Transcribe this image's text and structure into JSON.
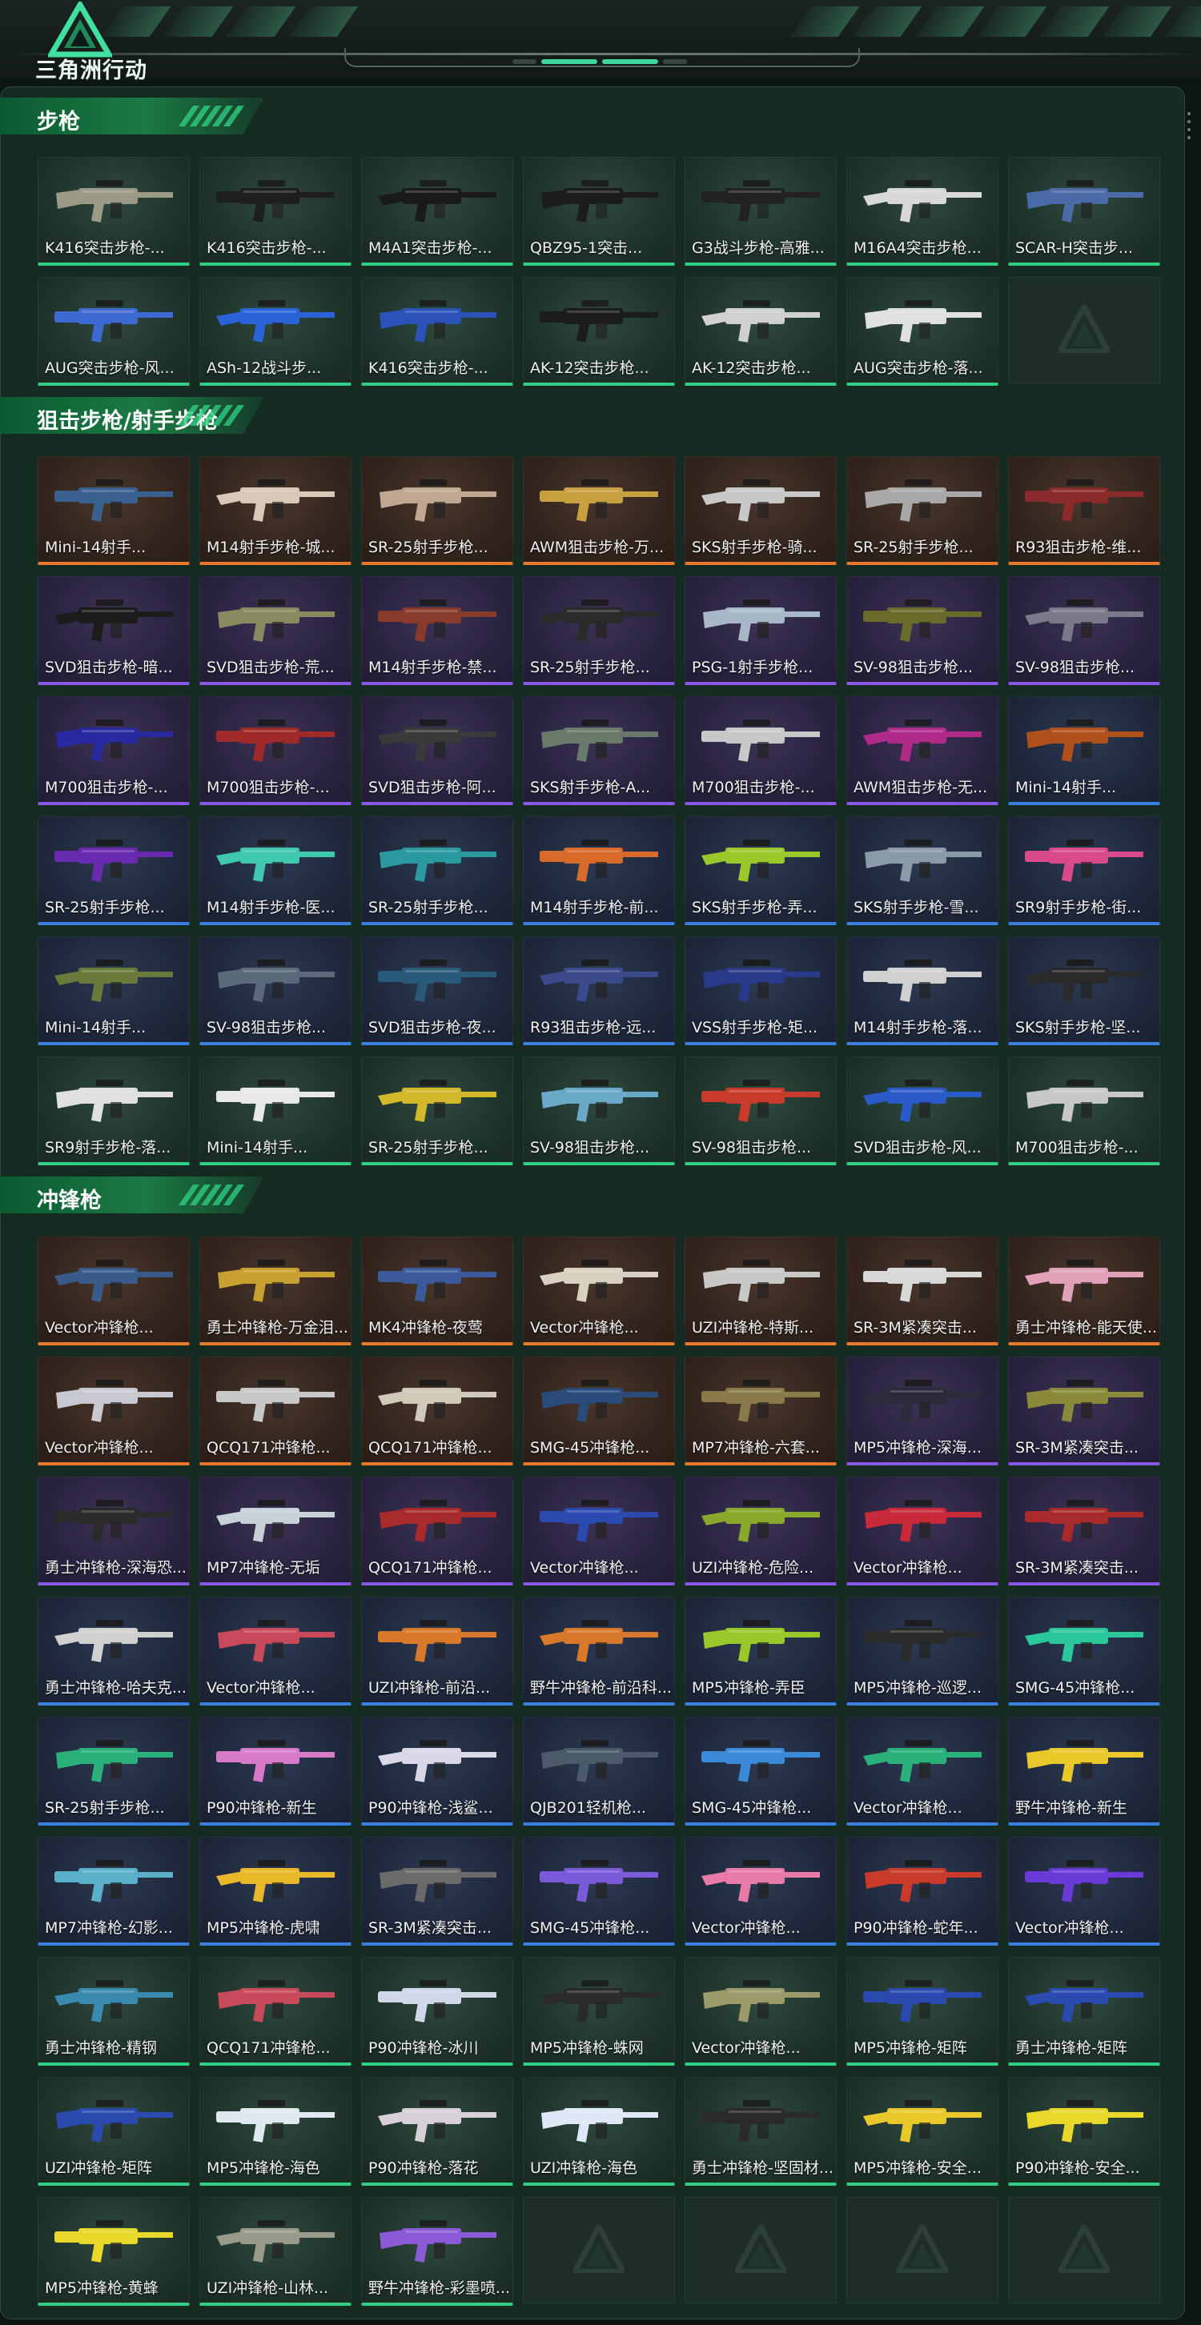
{
  "header": {
    "app_title": "三角洲行动",
    "logo_icon": "delta-logo-icon"
  },
  "rarity_colors": {
    "green": "#2fcf86",
    "orange": "#e8782a",
    "purple": "#8a58e6",
    "blue": "#3b7fe0"
  },
  "sections": [
    {
      "title": "步枪",
      "items": [
        {
          "name": "K416突击步枪-...",
          "rarity": "green",
          "gun_color": "#9a9a86"
        },
        {
          "name": "K416突击步枪-...",
          "rarity": "green",
          "gun_color": "#1e1e1e"
        },
        {
          "name": "M4A1突击步枪-...",
          "rarity": "green",
          "gun_color": "#1a1a1a"
        },
        {
          "name": "QBZ95-1突击...",
          "rarity": "green",
          "gun_color": "#1c1c1c"
        },
        {
          "name": "G3战斗步枪-高雅...",
          "rarity": "green",
          "gun_color": "#222222"
        },
        {
          "name": "M16A4突击步枪...",
          "rarity": "green",
          "gun_color": "#d8d8d8"
        },
        {
          "name": "SCAR-H突击步...",
          "rarity": "green",
          "gun_color": "#4a6aa8"
        },
        {
          "name": "AUG突击步枪-风...",
          "rarity": "green",
          "gun_color": "#3c6ad0"
        },
        {
          "name": "ASh-12战斗步...",
          "rarity": "green",
          "gun_color": "#2a62d8"
        },
        {
          "name": "K416突击步枪-...",
          "rarity": "green",
          "gun_color": "#2a52b8"
        },
        {
          "name": "AK-12突击步枪...",
          "rarity": "green",
          "gun_color": "#1c1c1c"
        },
        {
          "name": "AK-12突击步枪...",
          "rarity": "green",
          "gun_color": "#d0d0d0"
        },
        {
          "name": "AUG突击步枪-落...",
          "rarity": "green",
          "gun_color": "#e0e0e0"
        },
        {
          "name": "",
          "rarity": "empty"
        }
      ]
    },
    {
      "title": "狙击步枪/射手步枪",
      "items": [
        {
          "name": "Mini-14射手...",
          "rarity": "orange",
          "gun_color": "#3a6090"
        },
        {
          "name": "M14射手步枪-城...",
          "rarity": "orange",
          "gun_color": "#d8c8b8"
        },
        {
          "name": "SR-25射手步枪...",
          "rarity": "orange",
          "gun_color": "#c0a890"
        },
        {
          "name": "AWM狙击步枪-万...",
          "rarity": "orange",
          "gun_color": "#c8a040"
        },
        {
          "name": "SKS射手步枪-骑...",
          "rarity": "orange",
          "gun_color": "#c8c8c8"
        },
        {
          "name": "SR-25射手步枪...",
          "rarity": "orange",
          "gun_color": "#a8a8a8"
        },
        {
          "name": "R93狙击步枪-维...",
          "rarity": "orange",
          "gun_color": "#8a2a2a"
        },
        {
          "name": "SVD狙击步枪-暗...",
          "rarity": "purple",
          "gun_color": "#1c1c1c"
        },
        {
          "name": "SVD狙击步枪-荒...",
          "rarity": "purple",
          "gun_color": "#8a8a60"
        },
        {
          "name": "M14射手步枪-禁...",
          "rarity": "purple",
          "gun_color": "#8a3a2a"
        },
        {
          "name": "SR-25射手步枪...",
          "rarity": "purple",
          "gun_color": "#2a2a2a"
        },
        {
          "name": "PSG-1射手步枪...",
          "rarity": "purple",
          "gun_color": "#a8b8c8"
        },
        {
          "name": "SV-98狙击步枪...",
          "rarity": "purple",
          "gun_color": "#6a6a2a"
        },
        {
          "name": "SV-98狙击步枪...",
          "rarity": "purple",
          "gun_color": "#7a7a8a"
        },
        {
          "name": "M700狙击步枪-...",
          "rarity": "purple",
          "gun_color": "#2a2aa0"
        },
        {
          "name": "M700狙击步枪-...",
          "rarity": "purple",
          "gun_color": "#a02a2a"
        },
        {
          "name": "SVD狙击步枪-阿...",
          "rarity": "purple",
          "gun_color": "#3a3a3a"
        },
        {
          "name": "SKS射手步枪-A...",
          "rarity": "purple",
          "gun_color": "#6a7a6a"
        },
        {
          "name": "M700狙击步枪-...",
          "rarity": "purple",
          "gun_color": "#c8c8c8"
        },
        {
          "name": "AWM狙击步枪-无...",
          "rarity": "purple",
          "gun_color": "#b02a8a"
        },
        {
          "name": "Mini-14射手...",
          "rarity": "blue",
          "gun_color": "#b0501a"
        },
        {
          "name": "SR-25射手步枪...",
          "rarity": "blue",
          "gun_color": "#6a2ab0"
        },
        {
          "name": "M14射手步枪-医...",
          "rarity": "blue",
          "gun_color": "#40c8b0"
        },
        {
          "name": "SR-25射手步枪...",
          "rarity": "blue",
          "gun_color": "#2a9aa0"
        },
        {
          "name": "M14射手步枪-前...",
          "rarity": "blue",
          "gun_color": "#d86a2a"
        },
        {
          "name": "SKS射手步枪-弄...",
          "rarity": "blue",
          "gun_color": "#9ac82a"
        },
        {
          "name": "SKS射手步枪-雪...",
          "rarity": "blue",
          "gun_color": "#8a9aa8"
        },
        {
          "name": "SR9射手步枪-街...",
          "rarity": "blue",
          "gun_color": "#d84a8a"
        },
        {
          "name": "Mini-14射手...",
          "rarity": "blue",
          "gun_color": "#6a7a3a"
        },
        {
          "name": "SV-98狙击步枪...",
          "rarity": "blue",
          "gun_color": "#5a6a7a"
        },
        {
          "name": "SVD狙击步枪-夜...",
          "rarity": "blue",
          "gun_color": "#2a5a7a"
        },
        {
          "name": "R93狙击步枪-远...",
          "rarity": "blue",
          "gun_color": "#3a4a8a"
        },
        {
          "name": "VSS射手步枪-矩...",
          "rarity": "blue",
          "gun_color": "#2a3a8a"
        },
        {
          "name": "M14射手步枪-落...",
          "rarity": "blue",
          "gun_color": "#d0d0d0"
        },
        {
          "name": "SKS射手步枪-坚...",
          "rarity": "blue",
          "gun_color": "#2a2a2a"
        },
        {
          "name": "SR9射手步枪-落...",
          "rarity": "green",
          "gun_color": "#e0e0e0"
        },
        {
          "name": "Mini-14射手...",
          "rarity": "green",
          "gun_color": "#e8e8e8"
        },
        {
          "name": "SR-25射手步枪...",
          "rarity": "green",
          "gun_color": "#d0b82a"
        },
        {
          "name": "SV-98狙击步枪...",
          "rarity": "green",
          "gun_color": "#6aa8c8"
        },
        {
          "name": "SV-98狙击步枪...",
          "rarity": "green",
          "gun_color": "#c83a2a"
        },
        {
          "name": "SVD狙击步枪-风...",
          "rarity": "green",
          "gun_color": "#2a5ac8"
        },
        {
          "name": "M700狙击步枪-...",
          "rarity": "green",
          "gun_color": "#c8c8c8"
        }
      ]
    },
    {
      "title": "冲锋枪",
      "items": [
        {
          "name": "Vector冲锋枪...",
          "rarity": "orange",
          "gun_color": "#3a5a8a"
        },
        {
          "name": "勇士冲锋枪-万金泪...",
          "rarity": "orange",
          "gun_color": "#c8a030"
        },
        {
          "name": "MK4冲锋枪-夜莺",
          "rarity": "orange",
          "gun_color": "#3a5a9a"
        },
        {
          "name": "Vector冲锋枪...",
          "rarity": "orange",
          "gun_color": "#d8d0c0"
        },
        {
          "name": "UZI冲锋枪-特斯...",
          "rarity": "orange",
          "gun_color": "#c8c8c8"
        },
        {
          "name": "SR-3M紧凑突击...",
          "rarity": "orange",
          "gun_color": "#d8d8d8"
        },
        {
          "name": "勇士冲锋枪-能天使...",
          "rarity": "orange",
          "gun_color": "#e0a0b8"
        },
        {
          "name": "Vector冲锋枪...",
          "rarity": "orange",
          "gun_color": "#c8c8d0"
        },
        {
          "name": "QCQ171冲锋枪...",
          "rarity": "orange",
          "gun_color": "#c8c8c8"
        },
        {
          "name": "QCQ171冲锋枪...",
          "rarity": "orange",
          "gun_color": "#d0c8b8"
        },
        {
          "name": "SMG-45冲锋枪...",
          "rarity": "orange",
          "gun_color": "#2a4a7a"
        },
        {
          "name": "MP7冲锋枪-六套...",
          "rarity": "orange",
          "gun_color": "#8a7a4a"
        },
        {
          "name": "MP5冲锋枪-深海...",
          "rarity": "purple",
          "gun_color": "#2a2a3a"
        },
        {
          "name": "SR-3M紧凑突击...",
          "rarity": "purple",
          "gun_color": "#8a8a3a"
        },
        {
          "name": "勇士冲锋枪-深海恐...",
          "rarity": "purple",
          "gun_color": "#2a2a2a"
        },
        {
          "name": "MP7冲锋枪-无垢",
          "rarity": "purple",
          "gun_color": "#c8d0d8"
        },
        {
          "name": "QCQ171冲锋枪...",
          "rarity": "purple",
          "gun_color": "#a82a2a"
        },
        {
          "name": "Vector冲锋枪...",
          "rarity": "purple",
          "gun_color": "#2a4ab0"
        },
        {
          "name": "UZI冲锋枪-危险...",
          "rarity": "purple",
          "gun_color": "#8aa82a"
        },
        {
          "name": "Vector冲锋枪...",
          "rarity": "purple",
          "gun_color": "#c82a3a"
        },
        {
          "name": "SR-3M紧凑突击...",
          "rarity": "purple",
          "gun_color": "#a82a2a"
        },
        {
          "name": "勇士冲锋枪-哈夫克...",
          "rarity": "blue",
          "gun_color": "#d0d0d0"
        },
        {
          "name": "Vector冲锋枪...",
          "rarity": "blue",
          "gun_color": "#c84a5a"
        },
        {
          "name": "UZI冲锋枪-前沿...",
          "rarity": "blue",
          "gun_color": "#d8782a"
        },
        {
          "name": "野牛冲锋枪-前沿科...",
          "rarity": "blue",
          "gun_color": "#d8782a"
        },
        {
          "name": "MP5冲锋枪-弄臣",
          "rarity": "blue",
          "gun_color": "#9ac82a"
        },
        {
          "name": "MP5冲锋枪-巡逻...",
          "rarity": "blue",
          "gun_color": "#2a2a2a"
        },
        {
          "name": "SMG-45冲锋枪...",
          "rarity": "blue",
          "gun_color": "#2ac89a"
        },
        {
          "name": "SR-25射手步枪...",
          "rarity": "blue",
          "gun_color": "#2ab07a"
        },
        {
          "name": "P90冲锋枪-新生",
          "rarity": "blue",
          "gun_color": "#d87ac8"
        },
        {
          "name": "P90冲锋枪-浅鲨...",
          "rarity": "blue",
          "gun_color": "#d8d8e8"
        },
        {
          "name": "QJB201轻机枪...",
          "rarity": "blue",
          "gun_color": "#4a5a6a"
        },
        {
          "name": "SMG-45冲锋枪...",
          "rarity": "blue",
          "gun_color": "#3a8ad8"
        },
        {
          "name": "Vector冲锋枪...",
          "rarity": "blue",
          "gun_color": "#2ab07a"
        },
        {
          "name": "野牛冲锋枪-新生",
          "rarity": "blue",
          "gun_color": "#e8c82a"
        },
        {
          "name": "MP7冲锋枪-幻影...",
          "rarity": "blue",
          "gun_color": "#5ab0c8"
        },
        {
          "name": "MP5冲锋枪-虎啸",
          "rarity": "blue",
          "gun_color": "#e8b82a"
        },
        {
          "name": "SR-3M紧凑突击...",
          "rarity": "blue",
          "gun_color": "#6a6a6a"
        },
        {
          "name": "SMG-45冲锋枪...",
          "rarity": "blue",
          "gun_color": "#7a5ad8"
        },
        {
          "name": "Vector冲锋枪...",
          "rarity": "blue",
          "gun_color": "#e87aa8"
        },
        {
          "name": "P90冲锋枪-蛇年...",
          "rarity": "blue",
          "gun_color": "#c83a2a"
        },
        {
          "name": "Vector冲锋枪...",
          "rarity": "blue",
          "gun_color": "#6a3ad8"
        },
        {
          "name": "勇士冲锋枪-精钢",
          "rarity": "green",
          "gun_color": "#3a8ab0"
        },
        {
          "name": "QCQ171冲锋枪...",
          "rarity": "green",
          "gun_color": "#c84a5a"
        },
        {
          "name": "P90冲锋枪-冰川",
          "rarity": "green",
          "gun_color": "#d0d8e8"
        },
        {
          "name": "MP5冲锋枪-蛛网",
          "rarity": "green",
          "gun_color": "#2a2a2a"
        },
        {
          "name": "Vector冲锋枪...",
          "rarity": "green",
          "gun_color": "#9a9a6a"
        },
        {
          "name": "MP5冲锋枪-矩阵",
          "rarity": "green",
          "gun_color": "#2a4ab0"
        },
        {
          "name": "勇士冲锋枪-矩阵",
          "rarity": "green",
          "gun_color": "#2a4ab0"
        },
        {
          "name": "UZI冲锋枪-矩阵",
          "rarity": "green",
          "gun_color": "#2a4ab0"
        },
        {
          "name": "MP5冲锋枪-海色",
          "rarity": "green",
          "gun_color": "#e0e8f0"
        },
        {
          "name": "P90冲锋枪-落花",
          "rarity": "green",
          "gun_color": "#d8d0d8"
        },
        {
          "name": "UZI冲锋枪-海色",
          "rarity": "green",
          "gun_color": "#e0e8f8"
        },
        {
          "name": "勇士冲锋枪-坚固材...",
          "rarity": "green",
          "gun_color": "#2a2a2a"
        },
        {
          "name": "MP5冲锋枪-安全...",
          "rarity": "green",
          "gun_color": "#e8c82a"
        },
        {
          "name": "P90冲锋枪-安全...",
          "rarity": "green",
          "gun_color": "#e8d82a"
        },
        {
          "name": "MP5冲锋枪-黄蜂",
          "rarity": "green",
          "gun_color": "#e8d82a"
        },
        {
          "name": "UZI冲锋枪-山林...",
          "rarity": "green",
          "gun_color": "#9a9a8a"
        },
        {
          "name": "野牛冲锋枪-彩墨喷...",
          "rarity": "green",
          "gun_color": "#8a5ad8"
        },
        {
          "name": "",
          "rarity": "empty"
        },
        {
          "name": "",
          "rarity": "empty"
        },
        {
          "name": "",
          "rarity": "empty"
        },
        {
          "name": "",
          "rarity": "empty"
        }
      ]
    }
  ]
}
